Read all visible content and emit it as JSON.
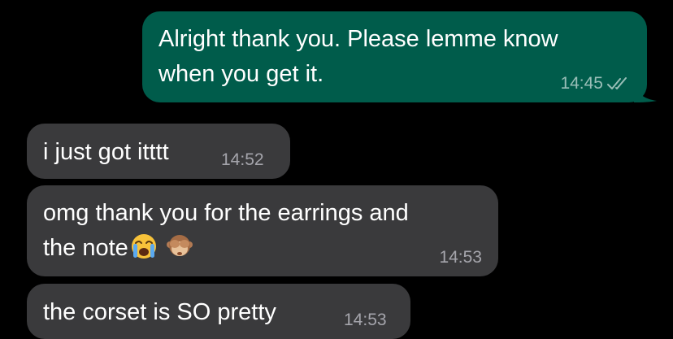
{
  "messages": [
    {
      "direction": "outgoing",
      "text": "Alright thank you. Please lemme know\nwhen you get it.",
      "time": "14:45",
      "status_icon": "double-check-icon"
    },
    {
      "direction": "incoming",
      "text": "i just got itttt",
      "time": "14:52"
    },
    {
      "direction": "incoming",
      "text_line1": "omg thank you for the earrings and",
      "text_line2": "the note",
      "emojis": [
        "loudly-crying-face-emoji",
        "see-no-evil-monkey-emoji"
      ],
      "time": "14:53"
    },
    {
      "direction": "incoming",
      "text": "the corset is SO pretty",
      "time": "14:53"
    }
  ],
  "colors": {
    "background": "#000000",
    "outgoing_bubble": "#005c4b",
    "incoming_bubble": "#3a3a3c",
    "text": "#ffffff"
  }
}
